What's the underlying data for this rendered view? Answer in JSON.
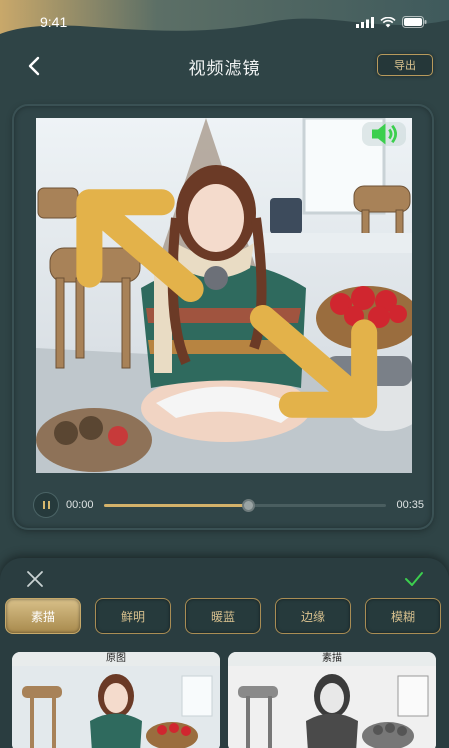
{
  "status": {
    "time": "9:41"
  },
  "nav": {
    "title": "视频滤镜",
    "export_label": "导出"
  },
  "player": {
    "current_time": "00:00",
    "duration": "00:35",
    "progress": 0.51
  },
  "filters": [
    {
      "label": "素描",
      "active": true
    },
    {
      "label": "鲜明",
      "active": false
    },
    {
      "label": "暖蓝",
      "active": false
    },
    {
      "label": "边缘",
      "active": false
    },
    {
      "label": "模糊",
      "active": false
    }
  ],
  "previews": {
    "original_label": "原图",
    "filtered_label": "素描"
  },
  "colors": {
    "accent": "#d4b26a",
    "background": "#2f4446",
    "sound": "#3ccf4e"
  }
}
